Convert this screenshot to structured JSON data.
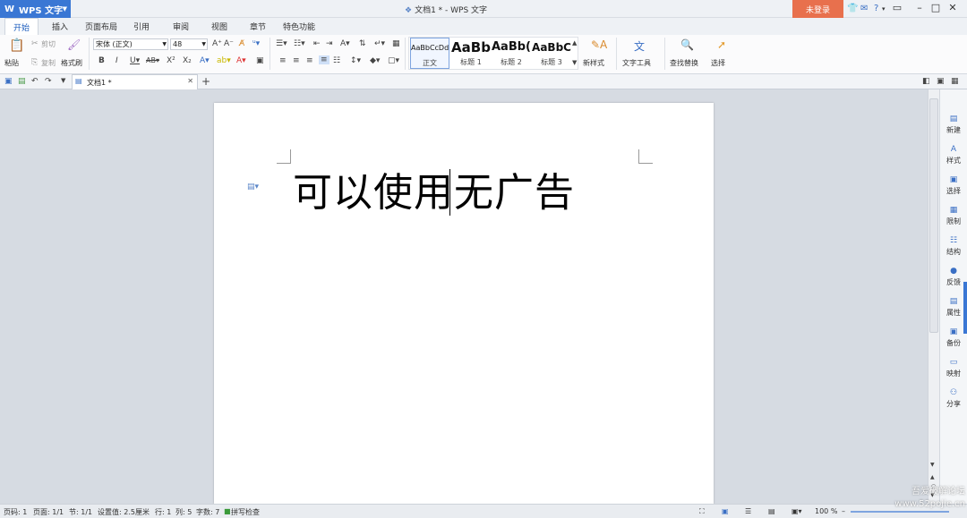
{
  "app": {
    "name": "WPS 文字",
    "logo": "W"
  },
  "title": "文档1 * - WPS 文字",
  "login_label": "未登录",
  "menu_tabs": [
    "开始",
    "插入",
    "页面布局",
    "引用",
    "审阅",
    "视图",
    "章节",
    "特色功能"
  ],
  "ribbon": {
    "paste": "粘贴",
    "cut": "剪切",
    "copy": "复制",
    "format_painter": "格式刷",
    "font_name": "宋体 (正文)",
    "font_size": "48",
    "styles": [
      {
        "preview": "AaBbCcDd",
        "name": "正文"
      },
      {
        "preview": "AaBb",
        "name": "标题 1"
      },
      {
        "preview": "AaBb(",
        "name": "标题 2"
      },
      {
        "preview": "AaBbC",
        "name": "标题 3"
      }
    ],
    "new_style": "新样式",
    "text_tools": "文字工具",
    "find_replace": "查找替换",
    "select": "选择"
  },
  "doc_tab": {
    "name": "文档1 *"
  },
  "document": {
    "text_before": "可以使用",
    "text_after": "无广告"
  },
  "sidebar": [
    "新建",
    "样式",
    "选择",
    "限制",
    "结构",
    "反馈",
    "属性",
    "备份",
    "映射",
    "分享"
  ],
  "status": {
    "page_num": "页码: 1",
    "pages": "页面: 1/1",
    "section": "节: 1/1",
    "setting": "设置值: 2.5厘米",
    "row": "行: 1",
    "col": "列: 5",
    "words": "字数: 7",
    "spell": "拼写检查",
    "zoom": "100 %"
  },
  "watermark": {
    "line1": "吾爱破解论坛",
    "line2": "www.52pojie.cn"
  },
  "colors": {
    "accent": "#3a77d4",
    "login": "#e8704d"
  }
}
